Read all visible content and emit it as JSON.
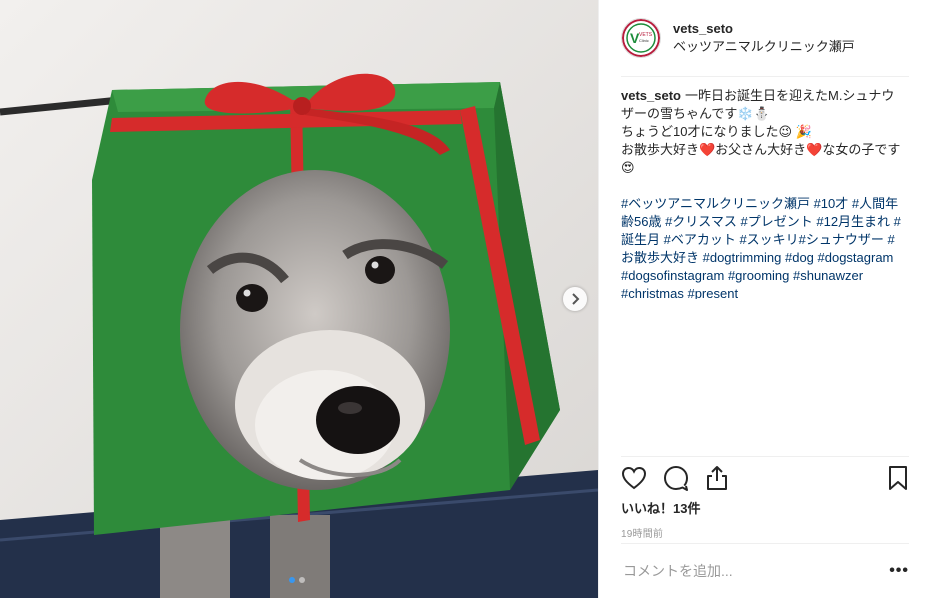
{
  "colors": {
    "accent": "#3897f0",
    "hashtag": "#003569",
    "gift_green": "#2e8b3a",
    "ribbon_red": "#d62b2b"
  },
  "post": {
    "username": "vets_seto",
    "location": "ベッツアニマルクリニック瀬戸",
    "caption_user": "vets_seto",
    "caption_text": "一昨日お誕生日を迎えたM.シュナウザーの雪ちゃんです❄️⛄\nちょうど10才になりました😉 🎉\nお散歩大好き❤️お父さん大好き❤️な女の子です😍",
    "hashtags": "#ベッツアニマルクリニック瀬戸 #10才 #人間年齢56歳 #クリスマス #プレゼント #12月生まれ #誕生月 #ベアカット #スッキリ#シュナウザー #お散歩大好き #dogtrimming #dog #dogstagram #dogsofinstagram #grooming #shunawzer #christmas #present",
    "likes": "いいね！13件",
    "timestamp": "19時間前",
    "comment_placeholder": "コメントを追加...",
    "more_label": "•••",
    "avatar_text": "VETS Animal Clinic"
  },
  "carousel": {
    "total": 2,
    "current": 1
  },
  "icons": {
    "like": "heart-icon",
    "comment": "comment-icon",
    "share": "share-icon",
    "save": "bookmark-icon",
    "next": "chevron-right-icon"
  }
}
